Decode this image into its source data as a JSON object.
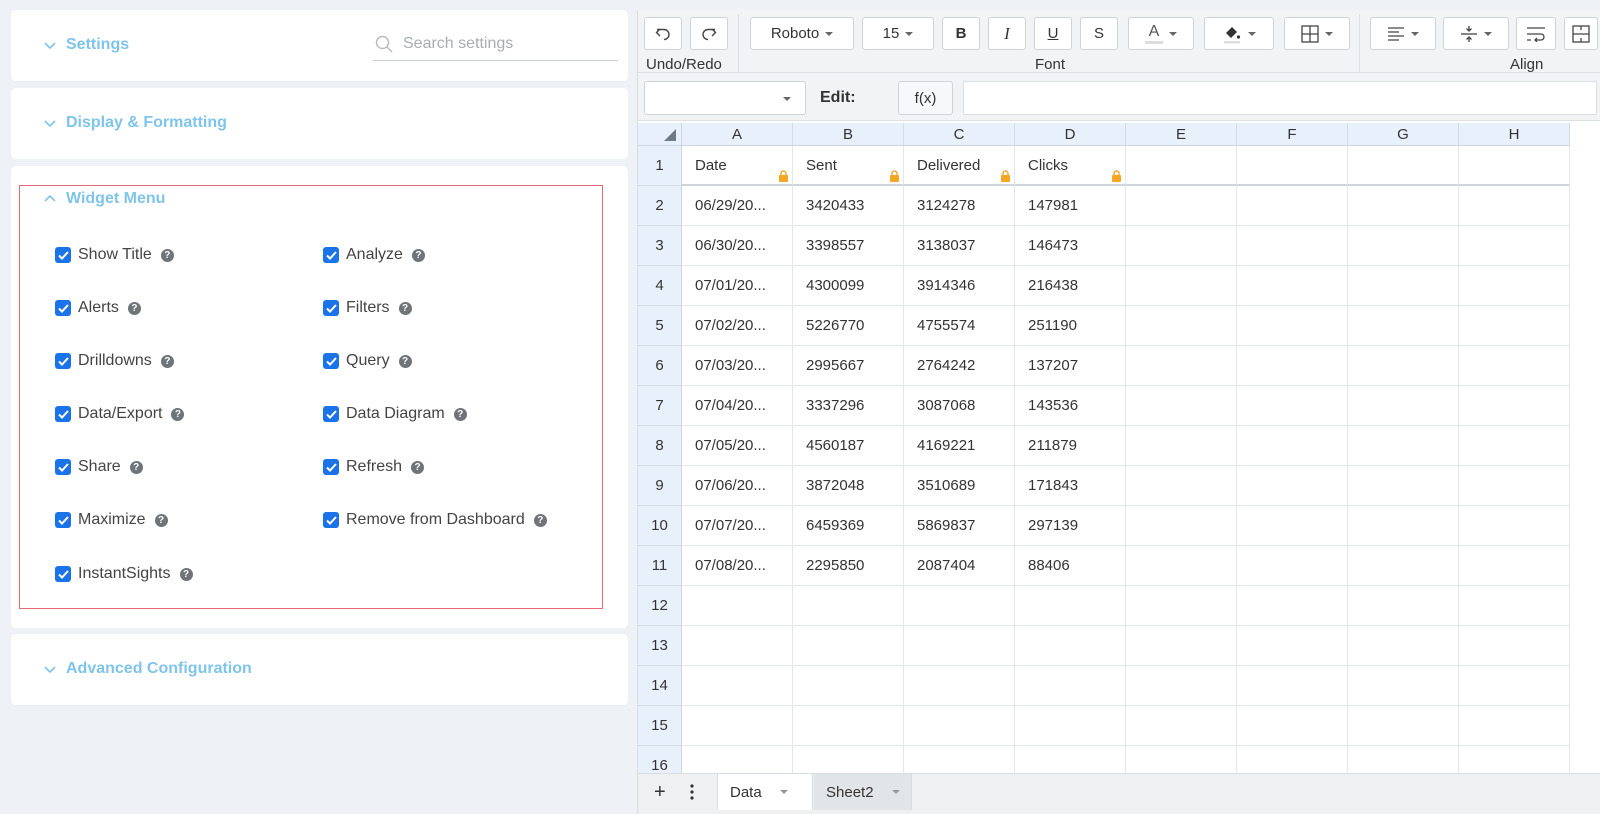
{
  "settings": {
    "title": "Settings",
    "search_placeholder": "Search settings"
  },
  "display_formatting": {
    "title": "Display & Formatting"
  },
  "widget_menu": {
    "title": "Widget Menu",
    "left_options": [
      "Show Title",
      "Alerts",
      "Drilldowns",
      "Data/Export",
      "Share",
      "Maximize",
      "InstantSights"
    ],
    "right_options": [
      "Analyze",
      "Filters",
      "Query",
      "Data Diagram",
      "Refresh",
      "Remove from Dashboard"
    ],
    "all_checked": true
  },
  "advanced_configuration": {
    "title": "Advanced Configuration"
  },
  "toolbar": {
    "undo_redo_label": "Undo/Redo",
    "font_label": "Font",
    "align_label": "Align",
    "font_family": "Roboto",
    "font_size": "15",
    "bold": "B",
    "italic": "I",
    "underline": "U",
    "strike": "S",
    "font_color_glyph": "A"
  },
  "formula_bar": {
    "edit_label": "Edit:",
    "fx_label": "f(x)",
    "value": ""
  },
  "grid": {
    "columns": [
      "A",
      "B",
      "C",
      "D",
      "E",
      "F",
      "G",
      "H"
    ],
    "rows": [
      [
        "Date",
        "Sent",
        "Delivered",
        "Clicks"
      ],
      [
        "06/29/20...",
        "3420433",
        "3124278",
        "147981"
      ],
      [
        "06/30/20...",
        "3398557",
        "3138037",
        "146473"
      ],
      [
        "07/01/20...",
        "4300099",
        "3914346",
        "216438"
      ],
      [
        "07/02/20...",
        "5226770",
        "4755574",
        "251190"
      ],
      [
        "07/03/20...",
        "2995667",
        "2764242",
        "137207"
      ],
      [
        "07/04/20...",
        "3337296",
        "3087068",
        "143536"
      ],
      [
        "07/05/20...",
        "4560187",
        "4169221",
        "211879"
      ],
      [
        "07/06/20...",
        "3872048",
        "3510689",
        "171843"
      ],
      [
        "07/07/20...",
        "6459369",
        "5869837",
        "297139"
      ],
      [
        "07/08/20...",
        "2295850",
        "2087404",
        "88406"
      ],
      [],
      [],
      [],
      [],
      []
    ],
    "row_numbers": [
      "1",
      "2",
      "3",
      "4",
      "5",
      "6",
      "7",
      "8",
      "9",
      "10",
      "11",
      "12",
      "13",
      "14",
      "15",
      "16"
    ]
  },
  "sheet_tabs": [
    "Data",
    "Sheet2"
  ],
  "colors": {
    "accent": "#7fc4ea",
    "checkbox": "#1a73e8",
    "highlight_frame": "#e46b74",
    "lock": "#f5a623"
  }
}
